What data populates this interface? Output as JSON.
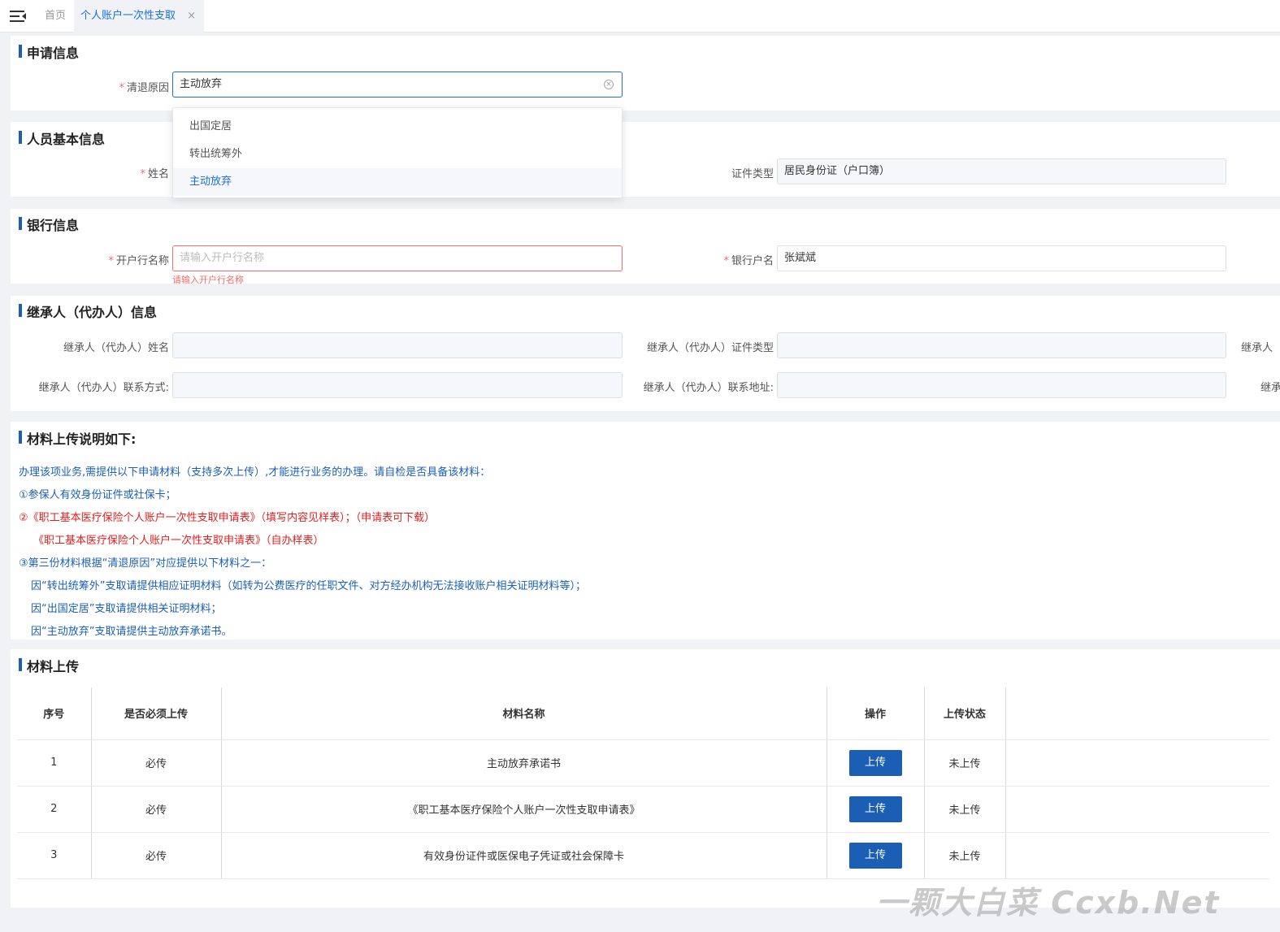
{
  "tabs": {
    "home": "首页",
    "active": "个人账户一次性支取",
    "close": "×"
  },
  "apply": {
    "title": "申请信息",
    "reason_label": "清退原因",
    "reason_value": "主动放弃",
    "options": [
      "出国定居",
      "转出统筹外",
      "主动放弃"
    ]
  },
  "person": {
    "title": "人员基本信息",
    "name_label": "姓名",
    "id_type_label": "证件类型",
    "id_type_value": "居民身份证（户口簿）"
  },
  "bank": {
    "title": "银行信息",
    "bank_name_label": "开户行名称",
    "bank_name_placeholder": "请输入开户行名称",
    "bank_name_error": "请输入开户行名称",
    "account_name_label": "银行户名",
    "account_name_value": "张斌斌"
  },
  "heir": {
    "title": "继承人（代办人）信息",
    "name_label": "继承人（代办人）姓名",
    "id_type_label": "继承人（代办人）证件类型",
    "id_no_label_partial": "继承人",
    "contact_label": "继承人（代办人）联系方式:",
    "address_label": "继承人（代办人）联系地址:",
    "extra_label_partial": "继承"
  },
  "instructions": {
    "title": "材料上传说明如下:",
    "lines": [
      "办理该项业务,需提供以下申请材料（支持多次上传）,才能进行业务的办理。请自检是否具备该材料：",
      "①参保人有效身份证件或社保卡；",
      "②《职工基本医疗保险个人账户一次性支取申请表》（填写内容见样表）；（申请表可下载）",
      "《职工基本医疗保险个人账户一次性支取申请表》（自办样表）",
      "③第三份材料根据“清退原因”对应提供以下材料之一：",
      "因“转出统筹外”支取请提供相应证明材料（如转为公费医疗的任职文件、对方经办机构无法接收账户相关证明材料等）；",
      "因“出国定居”支取请提供相关证明材料；",
      "因“主动放弃”支取请提供主动放弃承诺书。"
    ]
  },
  "upload": {
    "title": "材料上传",
    "headers": [
      "序号",
      "是否必须上传",
      "材料名称",
      "操作",
      "上传状态"
    ],
    "rows": [
      {
        "no": "1",
        "required": "必传",
        "name": "主动放弃承诺书",
        "action": "上传",
        "status": "未上传"
      },
      {
        "no": "2",
        "required": "必传",
        "name": "《职工基本医疗保险个人账户一次性支取申请表》",
        "action": "上传",
        "status": "未上传"
      },
      {
        "no": "3",
        "required": "必传",
        "name": "有效身份证件或医保电子凭证或社会保障卡",
        "action": "上传",
        "status": "未上传"
      }
    ]
  },
  "watermark": "一颗大白菜 Ccxb.Net"
}
